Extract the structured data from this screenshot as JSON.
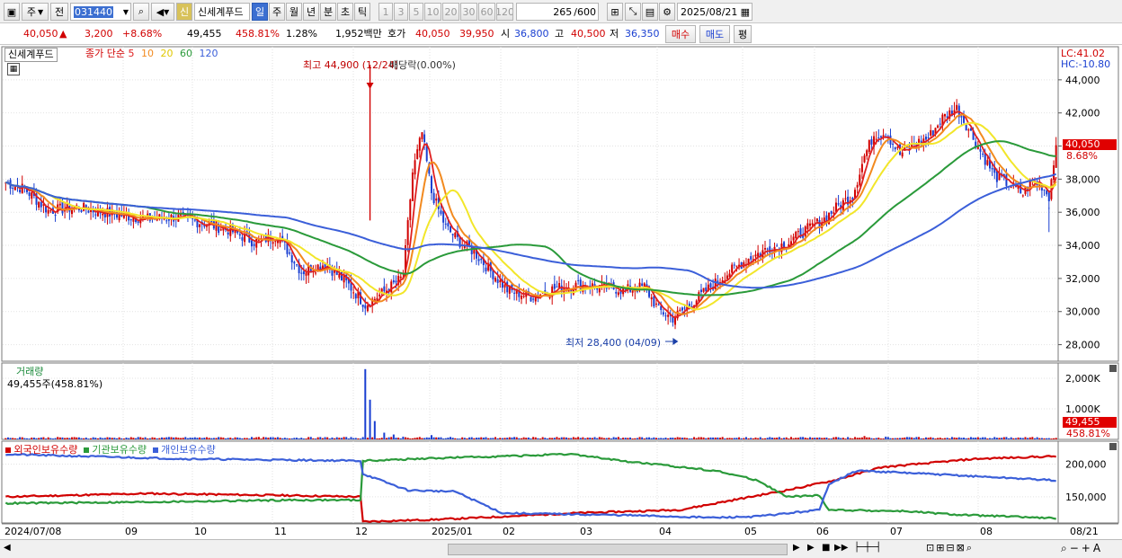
{
  "toolbar": {
    "mode_label": "주",
    "prev_label": "전",
    "code": "031440",
    "name": "신세계푸드",
    "sin_badge": "신",
    "periods": [
      "일",
      "주",
      "월",
      "년",
      "분",
      "초",
      "틱"
    ],
    "minutes": [
      "1",
      "3",
      "5",
      "10",
      "20",
      "30",
      "60",
      "120"
    ],
    "count": "265",
    "max": "/600",
    "date": "2025/08/21"
  },
  "quote": {
    "price": "40,050",
    "change": "3,200",
    "change_rate": "+8.68%",
    "volume": "49,455",
    "volume_rate": "458.81%",
    "turnover": "1.28%",
    "amount": "1,952백만",
    "ask_label": "호가",
    "ask": "40,050",
    "bid": "39,950",
    "open_label": "시",
    "open": "36,800",
    "high_label": "고",
    "high": "40,500",
    "low_label": "저",
    "low": "36,350",
    "buy_label": "매수",
    "sell_label": "매도",
    "avg_label": "평"
  },
  "colors": {
    "up": "#d10000",
    "down": "#1a3fd1",
    "ma5": "#e02020",
    "ma10": "#f28a1f",
    "ma20": "#f2e62a",
    "ma60": "#2a9a3a",
    "ma120": "#3b5fd9",
    "foreign": "#d10000",
    "inst": "#2a9a3a",
    "indiv": "#3b5fd9"
  },
  "chart_data": [
    {
      "type": "candlestick",
      "title": "신세계푸드",
      "legend_prefix": "종가 단순",
      "ma_periods": [
        "5",
        "10",
        "20",
        "60",
        "120"
      ],
      "ylim": [
        27000,
        46000
      ],
      "yticks": [
        "44,000",
        "42,000",
        "40,000",
        "38,000",
        "36,000",
        "34,000",
        "32,000",
        "30,000",
        "28,000"
      ],
      "ytick_values": [
        44000,
        42000,
        40000,
        38000,
        36000,
        34000,
        32000,
        30000,
        28000
      ],
      "xticks": [
        "2024/07/08",
        "09",
        "10",
        "11",
        "12",
        "2025/01",
        "02",
        "03",
        "04",
        "05",
        "06",
        "07",
        "08",
        "08/21"
      ],
      "close_path": [
        [
          0,
          37800
        ],
        [
          8,
          37400
        ],
        [
          18,
          36100
        ],
        [
          30,
          36300
        ],
        [
          45,
          35900
        ],
        [
          60,
          35600
        ],
        [
          72,
          35700
        ],
        [
          85,
          35300
        ],
        [
          95,
          34900
        ],
        [
          105,
          34200
        ],
        [
          115,
          34600
        ],
        [
          125,
          32400
        ],
        [
          135,
          32900
        ],
        [
          145,
          31600
        ],
        [
          152,
          30400
        ],
        [
          160,
          31200
        ],
        [
          168,
          32100
        ],
        [
          172,
          38400
        ],
        [
          176,
          40800
        ],
        [
          180,
          37200
        ],
        [
          186,
          35100
        ],
        [
          192,
          34200
        ],
        [
          198,
          33600
        ],
        [
          204,
          32600
        ],
        [
          212,
          31300
        ],
        [
          222,
          30900
        ],
        [
          232,
          31400
        ],
        [
          242,
          31600
        ],
        [
          252,
          31500
        ],
        [
          262,
          31300
        ],
        [
          270,
          31500
        ],
        [
          276,
          30100
        ],
        [
          282,
          29600
        ],
        [
          290,
          30500
        ],
        [
          298,
          31500
        ],
        [
          306,
          32400
        ],
        [
          314,
          33200
        ],
        [
          322,
          33800
        ],
        [
          330,
          34100
        ],
        [
          338,
          34900
        ],
        [
          346,
          35600
        ],
        [
          352,
          36400
        ],
        [
          358,
          37000
        ],
        [
          363,
          39400
        ],
        [
          367,
          40700
        ],
        [
          372,
          40800
        ],
        [
          378,
          39500
        ],
        [
          384,
          40100
        ],
        [
          390,
          40500
        ],
        [
          396,
          41700
        ],
        [
          402,
          42300
        ],
        [
          406,
          41300
        ],
        [
          412,
          39700
        ],
        [
          418,
          38200
        ],
        [
          424,
          37700
        ],
        [
          430,
          37100
        ],
        [
          434,
          37900
        ],
        [
          438,
          37600
        ],
        [
          441,
          36950
        ],
        [
          444,
          40050
        ]
      ],
      "last_close": 40050,
      "high_marker": {
        "label": "최고 44,900 (12/24)",
        "value": 44900
      },
      "event_label": "배당락(0.00%)",
      "low_marker": {
        "label": "최저 28,400 (04/09)",
        "value": 28400
      },
      "lc_label": "LC:41.02",
      "hc_label": "HC:-10.80",
      "price_tag": "40,050",
      "rate_tag": "8.68%"
    },
    {
      "type": "bar",
      "title": "거래량",
      "info": "49,455주(458.81%)",
      "ylim": [
        0,
        2500000
      ],
      "yticks": [
        "2,000K",
        "1,000K"
      ],
      "ytick_values": [
        2000000,
        1000000
      ],
      "spikes": [
        [
          152,
          2300000
        ],
        [
          154,
          1300000
        ],
        [
          156,
          600000
        ],
        [
          160,
          220000
        ],
        [
          164,
          160000
        ],
        [
          168,
          90000
        ],
        [
          180,
          140000
        ],
        [
          184,
          70000
        ],
        [
          200,
          60000
        ],
        [
          300,
          60000
        ],
        [
          306,
          50000
        ],
        [
          350,
          70000
        ],
        [
          363,
          110000
        ],
        [
          372,
          90000
        ]
      ],
      "base_volume": 45000,
      "value_tag": "49,455",
      "rate_tag": "458.81%"
    },
    {
      "type": "line",
      "legend": [
        "외국인보유수량",
        "기관보유수량",
        "개인보유수량"
      ],
      "ylim": [
        110000,
        235000
      ],
      "yticks": [
        "200,000",
        "150,000"
      ],
      "ytick_values": [
        200000,
        150000
      ],
      "series": [
        {
          "name": "외국인보유수량",
          "color": "#d10000",
          "points": [
            [
              0,
              150000
            ],
            [
              60,
              155000
            ],
            [
              120,
              152000
            ],
            [
              150,
              150000
            ],
            [
              151,
              112000
            ],
            [
              180,
              115000
            ],
            [
              200,
              118000
            ],
            [
              240,
              125000
            ],
            [
              285,
              130000
            ],
            [
              300,
              140000
            ],
            [
              330,
              160000
            ],
            [
              350,
              175000
            ],
            [
              370,
              195000
            ],
            [
              410,
              208000
            ],
            [
              444,
              212000
            ]
          ]
        },
        {
          "name": "기관보유수량",
          "color": "#2a9a3a",
          "points": [
            [
              0,
              140000
            ],
            [
              60,
              142000
            ],
            [
              120,
              145000
            ],
            [
              150,
              145000
            ],
            [
              151,
              205000
            ],
            [
              190,
              210000
            ],
            [
              240,
              215000
            ],
            [
              260,
              205000
            ],
            [
              300,
              190000
            ],
            [
              318,
              175000
            ],
            [
              330,
              150000
            ],
            [
              344,
              152000
            ],
            [
              348,
              130000
            ],
            [
              380,
              128000
            ],
            [
              400,
              123000
            ],
            [
              444,
              117000
            ]
          ]
        },
        {
          "name": "개인보유수량",
          "color": "#3b5fd9",
          "points": [
            [
              0,
              215000
            ],
            [
              75,
              208000
            ],
            [
              150,
              205000
            ],
            [
              151,
              185000
            ],
            [
              170,
              160000
            ],
            [
              190,
              158000
            ],
            [
              210,
              125000
            ],
            [
              260,
              122000
            ],
            [
              300,
              118000
            ],
            [
              318,
              120000
            ],
            [
              344,
              130000
            ],
            [
              348,
              170000
            ],
            [
              360,
              190000
            ],
            [
              390,
              185000
            ],
            [
              444,
              175000
            ]
          ]
        }
      ]
    }
  ]
}
